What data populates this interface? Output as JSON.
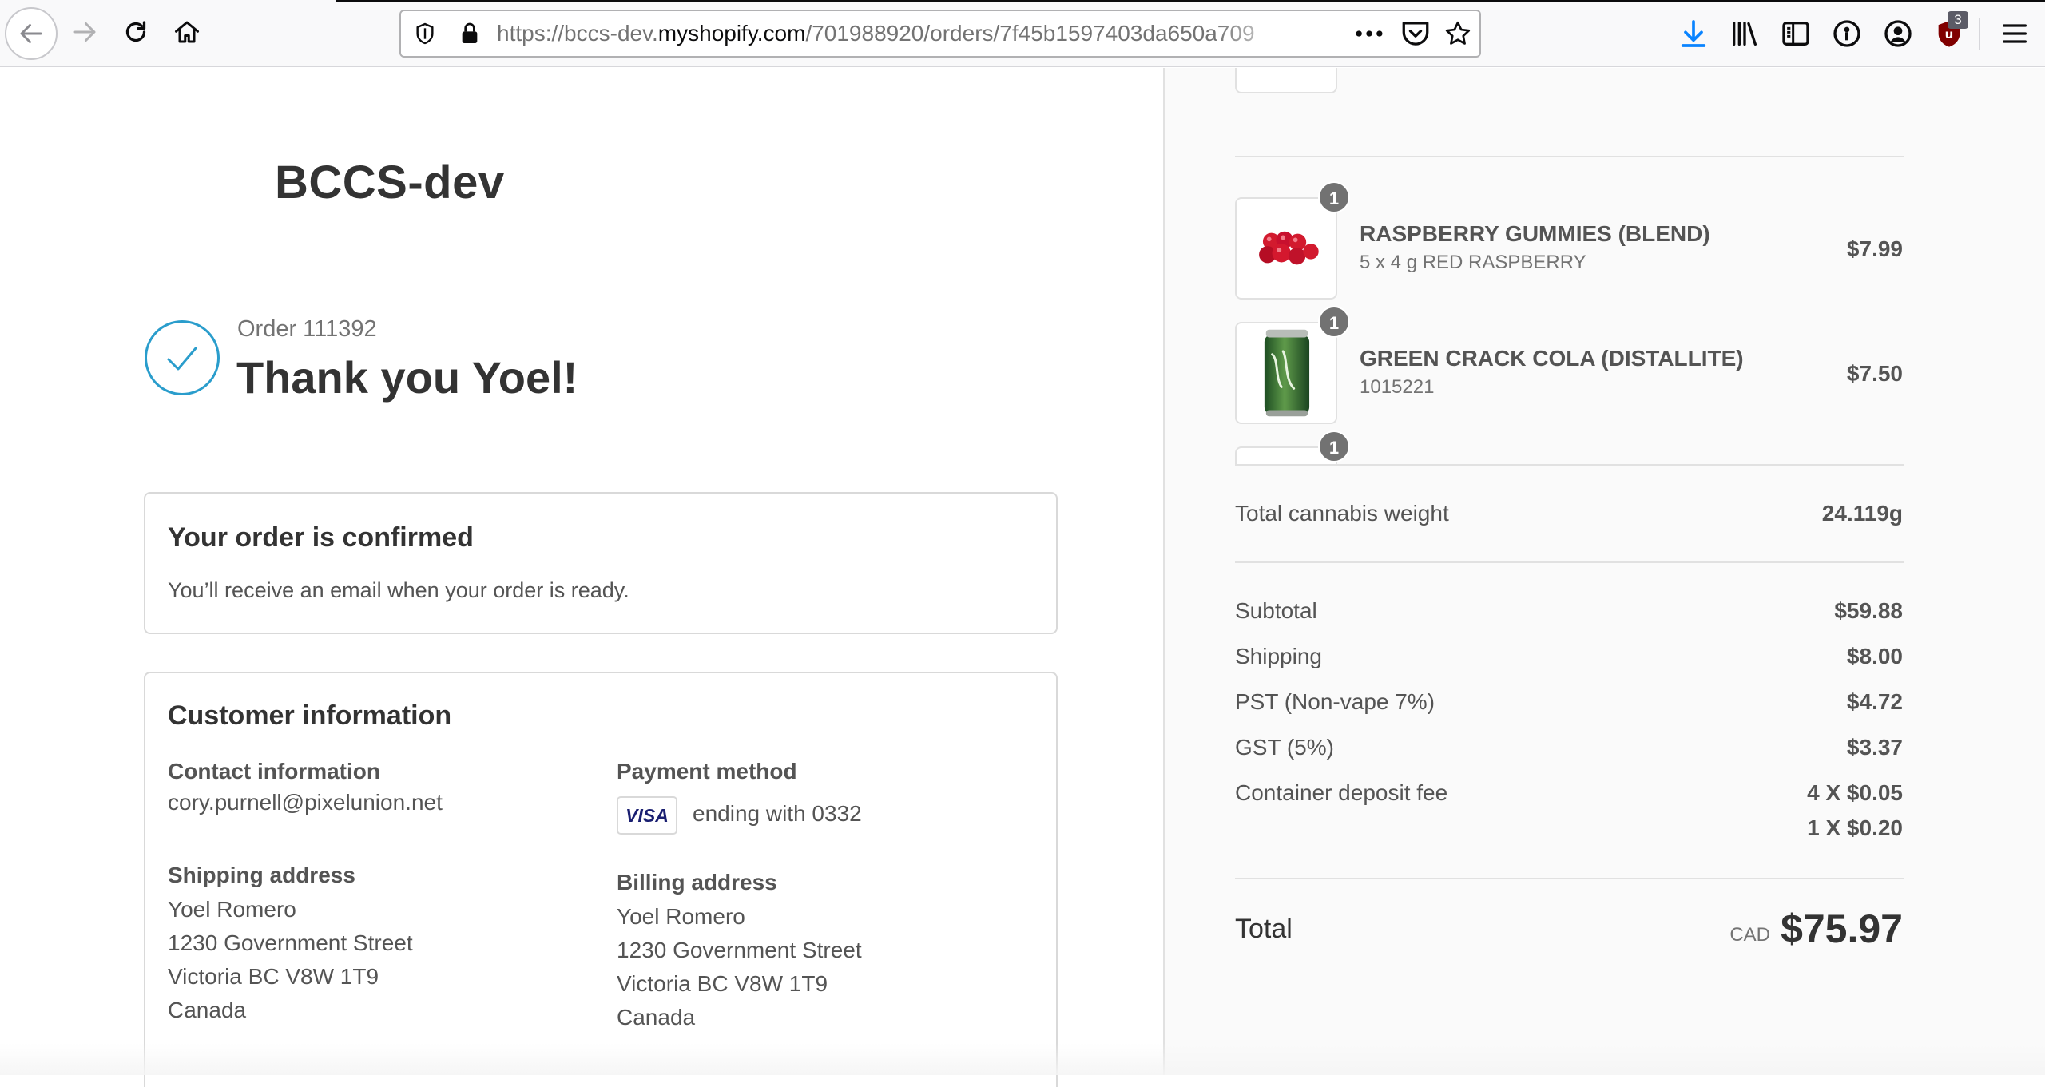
{
  "browser": {
    "url_prefix": "https://bccs-dev.",
    "url_host": "myshopify.com",
    "url_path": "/701988920/orders/7f45b1597403da650a709",
    "extension_badge": "3"
  },
  "icons": {
    "back": "arrow-left-icon",
    "forward": "arrow-right-icon",
    "reload": "reload-icon",
    "home": "home-icon",
    "shield": "tracking-shield-icon",
    "lock": "lock-icon",
    "page_actions": "ellipsis-icon",
    "pocket": "pocket-icon",
    "bookmark": "star-icon",
    "downloads": "download-arrow-icon",
    "library": "library-icon",
    "sidebar": "sidebar-icon",
    "lockwise": "lockwise-icon",
    "account": "account-icon",
    "extension": "ublock-shield-icon",
    "menu": "hamburger-menu-icon",
    "order_status": "check-circle-icon"
  },
  "colors": {
    "accent": "#2a9dcc",
    "download_blue": "#0a84ff",
    "ublock_red": "#800000",
    "badge_gray": "#727272"
  },
  "shop": {
    "name": "BCCS-dev"
  },
  "order": {
    "number_label": "Order 111392",
    "thank_you": "Thank you Yoel!"
  },
  "confirmation": {
    "title": "Your order is confirmed",
    "text": "You’ll receive an email when your order is ready."
  },
  "customer": {
    "title": "Customer information",
    "contact_label": "Contact information",
    "contact_email": "cory.purnell@pixelunion.net",
    "payment_label": "Payment method",
    "payment_brand": "VISA",
    "payment_text": "ending with 0332",
    "shipping_label": "Shipping address",
    "shipping_lines": [
      "Yoel Romero",
      "1230 Government Street",
      "Victoria BC V8W 1T9",
      "Canada"
    ],
    "billing_label": "Billing address",
    "billing_lines": [
      "Yoel Romero",
      "1230 Government Street",
      "Victoria BC V8W 1T9",
      "Canada"
    ]
  },
  "summary": {
    "products": [
      {
        "qty": "1",
        "name": "RASPBERRY GUMMIES (BLEND)",
        "sub": "5 x 4 g RED RASPBERRY",
        "price": "$7.99",
        "image": "raspberry-gummies-image"
      },
      {
        "qty": "1",
        "name": "GREEN CRACK COLA (DISTALLITE)",
        "sub": "1015221",
        "price": "$7.50",
        "image": "green-cola-can-image"
      },
      {
        "qty": "1"
      }
    ],
    "weight_label": "Total cannabis weight",
    "weight_value": "24.119g",
    "subtotal_label": "Subtotal",
    "subtotal_value": "$59.88",
    "shipping_label": "Shipping",
    "shipping_value": "$8.00",
    "pst_label": "PST (Non-vape 7%)",
    "pst_value": "$4.72",
    "gst_label": "GST (5%)",
    "gst_value": "$3.37",
    "deposit_label": "Container deposit fee",
    "deposit_value_1": "4 X $0.05",
    "deposit_value_2": "1 X $0.20",
    "total_label": "Total",
    "total_currency": "CAD",
    "total_value": "$75.97"
  }
}
